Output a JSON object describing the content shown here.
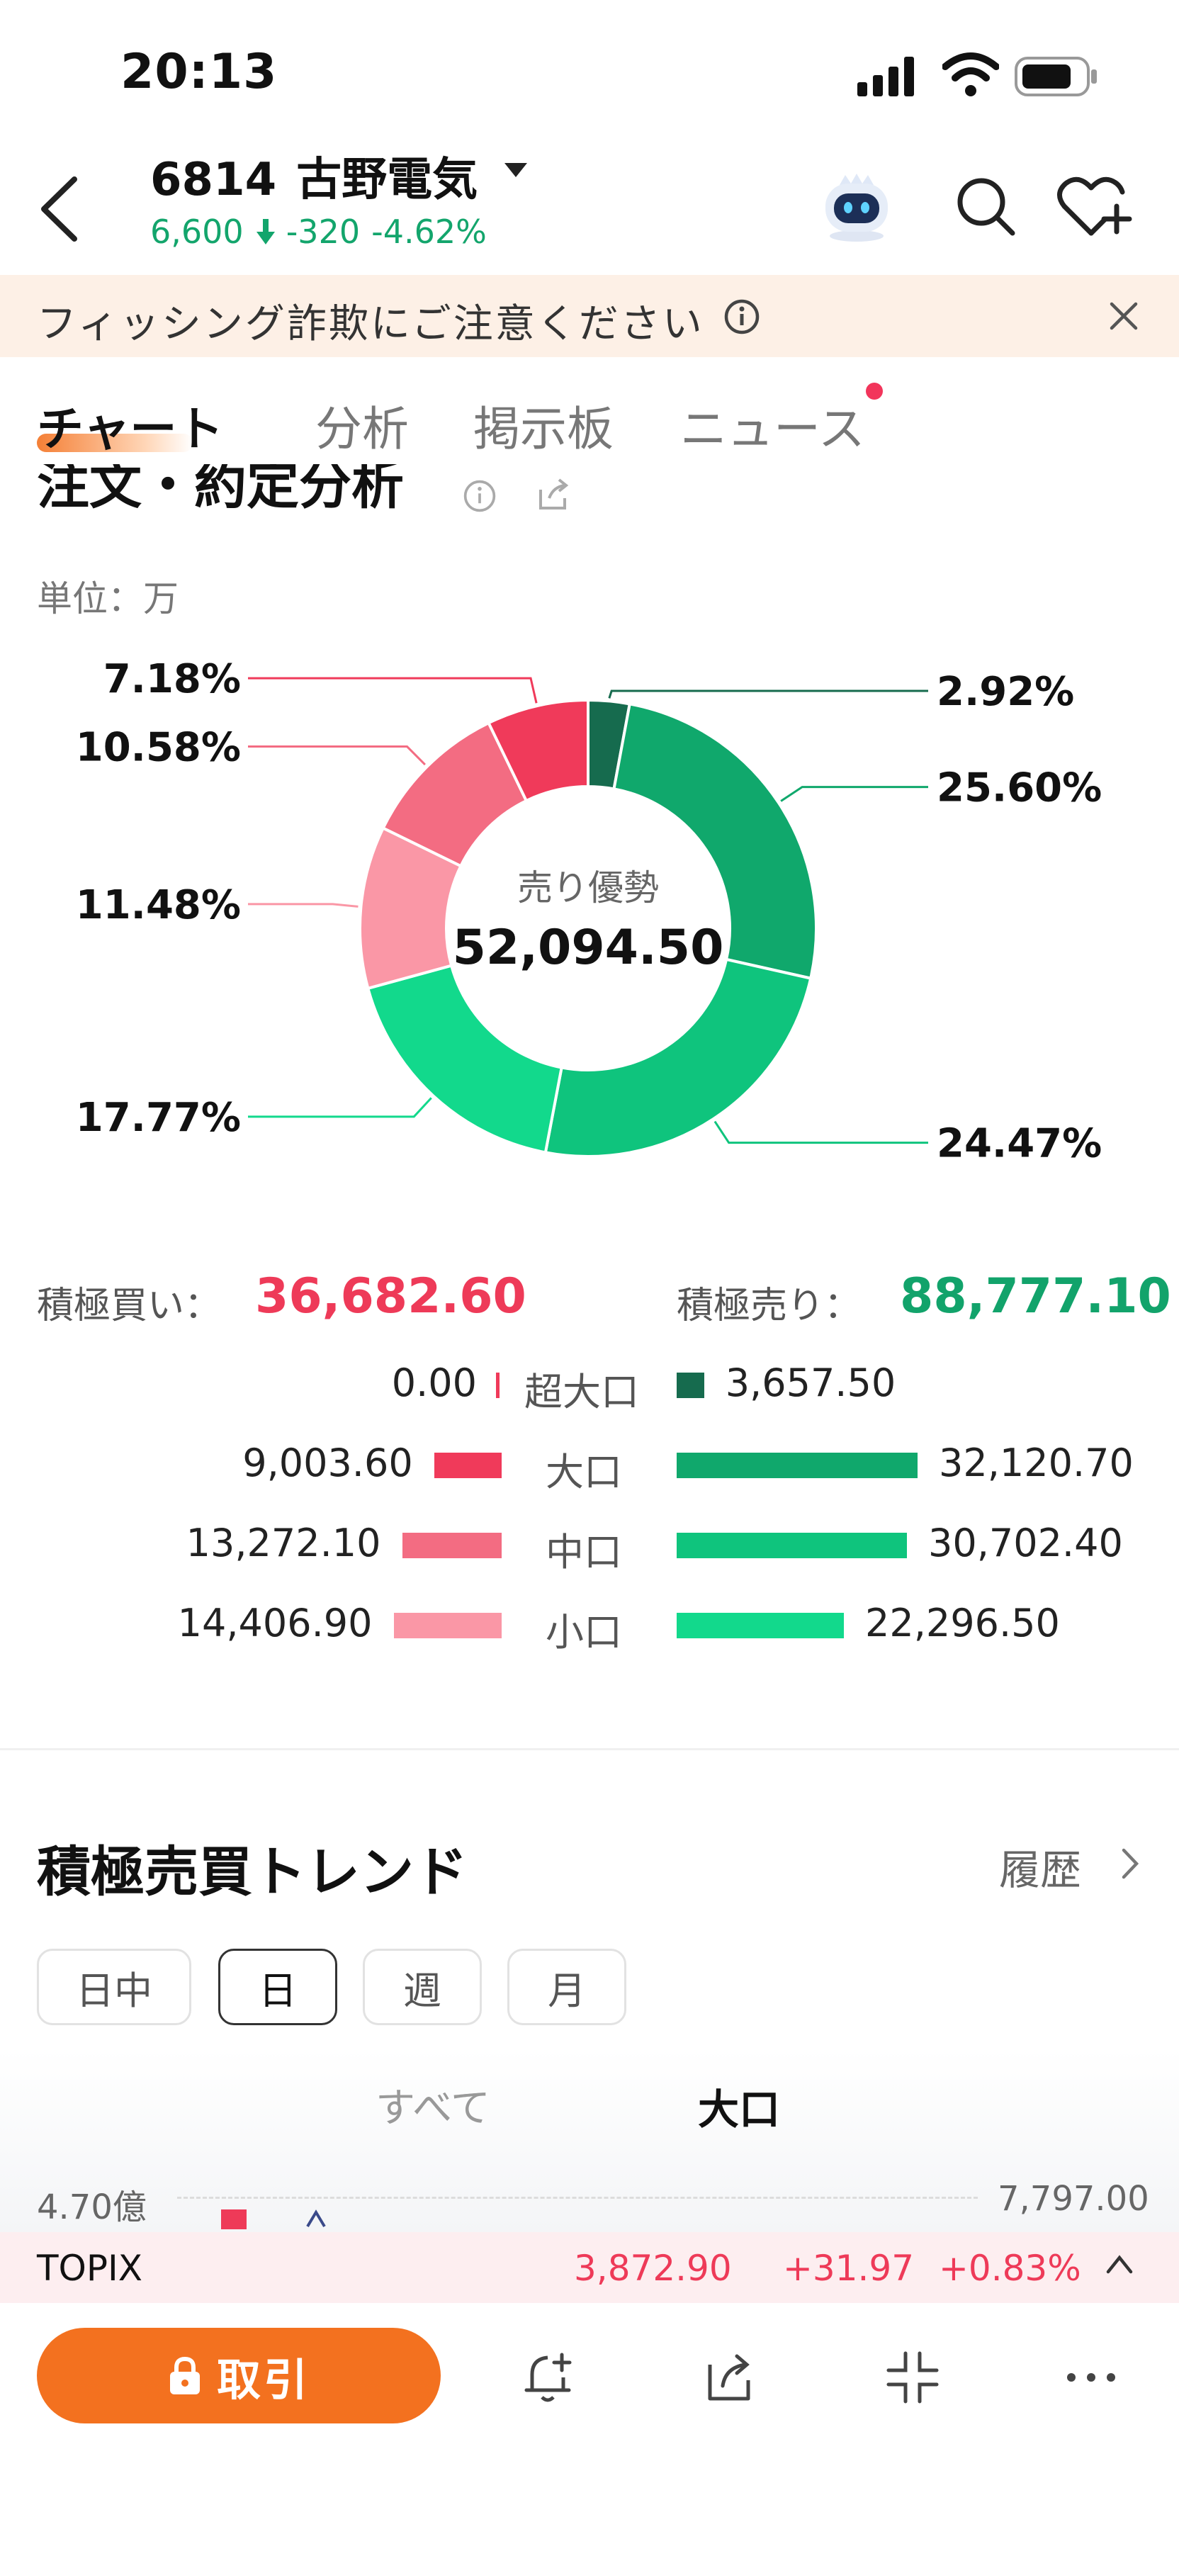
{
  "status_bar": {
    "time": "20:13"
  },
  "header": {
    "code": "6814",
    "name": "古野電気",
    "price": "6,600",
    "change": "-320",
    "change_pct": "-4.62%"
  },
  "banner": {
    "text": "フィッシング詐欺にご注意ください"
  },
  "tabs": [
    {
      "label": "チャート"
    },
    {
      "label": "分析"
    },
    {
      "label": "掲示板"
    },
    {
      "label": "ニュース"
    }
  ],
  "section": {
    "title": "注文・約定分析",
    "unit": "単位：万"
  },
  "donut": {
    "center_label": "売り優勢",
    "center_value": "52,094.50",
    "slices": [
      {
        "label": "2.92%",
        "value": 2.92,
        "color": "#166b4e"
      },
      {
        "label": "25.60%",
        "value": 25.6,
        "color": "#10a86c"
      },
      {
        "label": "24.47%",
        "value": 24.47,
        "color": "#0fc47d"
      },
      {
        "label": "17.77%",
        "value": 17.77,
        "color": "#12d98c"
      },
      {
        "label": "11.48%",
        "value": 11.48,
        "color": "#fa97a6"
      },
      {
        "label": "10.58%",
        "value": 10.58,
        "color": "#f36c82"
      },
      {
        "label": "7.18%",
        "value": 7.18,
        "color": "#f03a5a"
      }
    ]
  },
  "totals": {
    "buy_label": "積極買い：",
    "buy_value": "36,682.60",
    "sell_label": "積極売り：",
    "sell_value": "88,777.10"
  },
  "breakdown": [
    {
      "category": "超大口",
      "buy": "0.00",
      "buy_value": 0.0,
      "sell": "3,657.50",
      "sell_value": 3657.5,
      "buy_color": "#f03a5a",
      "sell_color": "#166b4e"
    },
    {
      "category": "大口",
      "buy": "9,003.60",
      "buy_value": 9003.6,
      "sell": "32,120.70",
      "sell_value": 32120.7,
      "buy_color": "#f03a5a",
      "sell_color": "#10a86c"
    },
    {
      "category": "中口",
      "buy": "13,272.10",
      "buy_value": 13272.1,
      "sell": "30,702.40",
      "sell_value": 30702.4,
      "buy_color": "#f36c82",
      "sell_color": "#0fc47d"
    },
    {
      "category": "小口",
      "buy": "14,406.90",
      "buy_value": 14406.9,
      "sell": "22,296.50",
      "sell_value": 22296.5,
      "buy_color": "#fa97a6",
      "sell_color": "#12d98c"
    }
  ],
  "trend": {
    "title": "積極売買トレンド",
    "history": "履歴",
    "periods": [
      "日中",
      "日",
      "週",
      "月"
    ],
    "selected_period": "日",
    "filters": [
      "すべて",
      "大口"
    ],
    "y_left": "4.70億",
    "y_right": "7,797.00"
  },
  "topix": {
    "name": "TOPIX",
    "price": "3,872.90",
    "change": "+31.97",
    "change_pct": "+0.83%"
  },
  "bottom": {
    "trade_label": "取引"
  },
  "colors": {
    "accent": "#f3711f",
    "up": "#ee3a58",
    "down": "#12a36b"
  }
}
